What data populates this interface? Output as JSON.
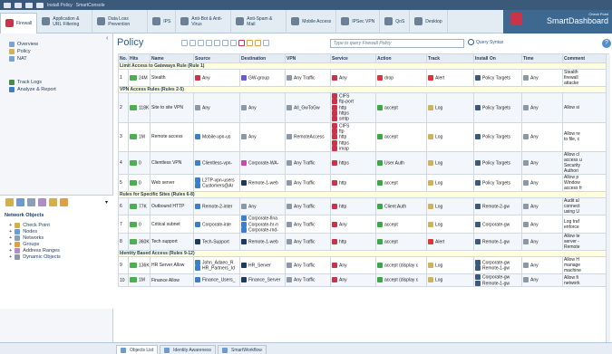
{
  "window": {
    "menu": "Install Policy",
    "console": "SmartConsole"
  },
  "ribbon": [
    {
      "label": "Firewall",
      "color": "#c8354a"
    },
    {
      "label": "Application & URL Filtering",
      "color": "#6b7f95"
    },
    {
      "label": "Data Loss Prevention",
      "color": "#6b7f95"
    },
    {
      "label": "IPS",
      "color": "#6b7f95"
    },
    {
      "label": "Anti-Bot & Anti-Virus",
      "color": "#6b7f95"
    },
    {
      "label": "Anti-Spam & Mail",
      "color": "#6b7f95"
    },
    {
      "label": "Mobile Access",
      "color": "#6b7f95"
    },
    {
      "label": "IPSec VPN",
      "color": "#6b7f95"
    },
    {
      "label": "QoS",
      "color": "#6b7f95"
    },
    {
      "label": "Desktop",
      "color": "#6b7f95"
    }
  ],
  "brand": {
    "vendor": "Check Point",
    "product": "SmartDashboard"
  },
  "leftpane": {
    "top_items": [
      "Overview",
      "Policy",
      "NAT"
    ],
    "mid_items": [
      "Track Logs",
      "Analyze & Report"
    ],
    "tree_title": "Network Objects",
    "tree_items": [
      "Check Point",
      "Nodes",
      "Networks",
      "Groups",
      "Address Ranges",
      "Dynamic Objects"
    ]
  },
  "main": {
    "title": "Policy",
    "search_placeholder": "Type to query Firewall Policy",
    "search_syntax": "Query Syntax",
    "headers": [
      "No.",
      "Hits",
      "Name",
      "Source",
      "Destination",
      "VPN",
      "Service",
      "Action",
      "Track",
      "Install On",
      "Time",
      "Comment"
    ]
  },
  "rows": [
    {
      "type": "section",
      "text": "Limit Access to Gateways Rule  (Rule 1)"
    },
    {
      "type": "rule",
      "no": "1",
      "hits": "24M",
      "name": "Stealth",
      "src": [
        "Any"
      ],
      "dst": [
        "GW-group"
      ],
      "vpn": "Any Traffic",
      "svc": [
        "Any"
      ],
      "action": "drop",
      "action_color": "#d9373a",
      "track": "Alert",
      "install": "Policy Targets",
      "time": "Any",
      "comment": [
        "Stealth",
        "firewall",
        "attacke"
      ],
      "dst_color": "#6b5bd6",
      "src_color": "#c8354a"
    },
    {
      "type": "section",
      "text": "VPN Access Rules  (Rules 2-5)"
    },
    {
      "type": "rule",
      "no": "2",
      "hits": "118K",
      "name": "Site to site VPN",
      "src": [
        "Any"
      ],
      "dst": [
        "Any"
      ],
      "vpn": "All_GwToGw",
      "svc": [
        "CIFS",
        "ftp-port",
        "http",
        "https",
        "smtp"
      ],
      "action": "accept",
      "action_color": "#39a845",
      "track": "Log",
      "install": "Policy Targets",
      "time": "Any",
      "comment": [
        "Allow si"
      ],
      "dst_color": "#8a98a8",
      "src_color": "#8a98a8"
    },
    {
      "type": "rule",
      "no": "3",
      "hits": "1M",
      "name": "Remote access",
      "src": [
        "Mobile-vpn-us"
      ],
      "dst": [
        "Any"
      ],
      "vpn": "RemoteAccess",
      "svc": [
        "CIFS",
        "ftp",
        "http",
        "https",
        "imap"
      ],
      "action": "accept",
      "action_color": "#39a845",
      "track": "Log",
      "install": "Policy Targets",
      "time": "Any",
      "comment": [
        "Allow re",
        "to file, c"
      ],
      "dst_color": "#8a98a8",
      "src_color": "#3b7fc9"
    },
    {
      "type": "rule",
      "no": "4",
      "hits": "0",
      "name": "Clientless VPN",
      "src": [
        "Clientless-vpn-"
      ],
      "dst": [
        "Corporate-WA-"
      ],
      "vpn": "Any Traffic",
      "svc": [
        "https"
      ],
      "action": "User Auth",
      "action_color": "#39a845",
      "track": "Log",
      "install": "Policy Targets",
      "time": "Any",
      "comment": [
        "Allow cl",
        "access u",
        "Security",
        "Authori"
      ],
      "dst_color": "#c84aa8",
      "src_color": "#3b7fc9"
    },
    {
      "type": "rule",
      "no": "5",
      "hits": "0",
      "name": "Web server",
      "src": [
        "L2TP-vpn-users",
        "Customers@Ar"
      ],
      "dst": [
        "Remote-1-web"
      ],
      "vpn": "Any Traffic",
      "svc": [
        "http"
      ],
      "action": "accept",
      "action_color": "#39a845",
      "track": "Log",
      "install": "Policy Targets",
      "time": "Any",
      "comment": [
        "Allow p",
        "Window",
        "access fr"
      ],
      "dst_color": "#1d3a5a",
      "src_color": "#3b7fc9"
    },
    {
      "type": "section",
      "text": "Rules for Specific Sites  (Rules 6-8)"
    },
    {
      "type": "rule",
      "no": "6",
      "hits": "77K",
      "name": "Outbound HTTP",
      "src": [
        "Remote-2-inter"
      ],
      "dst": [
        "Any"
      ],
      "vpn": "Any Traffic",
      "svc": [
        "http"
      ],
      "action": "Client Auth",
      "action_color": "#39a845",
      "track": "Log",
      "install": "Remote-2-gw",
      "time": "Any",
      "comment": [
        "Audit al",
        "connect",
        "using U"
      ],
      "dst_color": "#8a98a8",
      "src_color": "#3b7fc9"
    },
    {
      "type": "rule",
      "no": "7",
      "hits": "0",
      "name": "Critical subnet",
      "src": [
        "Corporate-inte"
      ],
      "dst": [
        "Corporate-fina",
        "Corporate-hr-n",
        "Corporate-rnd-"
      ],
      "vpn": "Any Traffic",
      "svc": [
        "Any"
      ],
      "action": "accept",
      "action_color": "#39a845",
      "track": "Log",
      "install": "Corporate-gw",
      "time": "Any",
      "comment": [
        "Log traf",
        "enforce"
      ],
      "dst_color": "#3b7fc9",
      "src_color": "#3b7fc9"
    },
    {
      "type": "rule",
      "no": "8",
      "hits": "360K",
      "name": "Tech support",
      "src": [
        "Tech-Support"
      ],
      "dst": [
        "Remote-1-web"
      ],
      "vpn": "Any Traffic",
      "svc": [
        "http"
      ],
      "action": "accept",
      "action_color": "#39a845",
      "track": "Alert",
      "install": "Remote-1-gw",
      "time": "Any",
      "comment": [
        "Allow te",
        "server -",
        "Remote"
      ],
      "dst_color": "#1d3a5a",
      "src_color": "#1d3a5a"
    },
    {
      "type": "section",
      "text": "Identity Based Access  (Rules 9-12)"
    },
    {
      "type": "rule",
      "no": "9",
      "hits": "136K",
      "name": "HR Server Allow",
      "src": [
        "John_Adaeo_R",
        "HR_Partners_Id"
      ],
      "dst": [
        "HR_Server"
      ],
      "vpn": "Any Traffic",
      "svc": [
        "Any"
      ],
      "action": "accept (display c",
      "action_color": "#39a845",
      "track": "Log",
      "install": "Corporate-gw",
      "install2": "Remote-1-gw",
      "time": "Any",
      "comment": [
        "Allow H",
        "manage",
        "machine"
      ],
      "dst_color": "#1d3a5a",
      "src_color": "#3b7fc9"
    },
    {
      "type": "rule",
      "no": "10",
      "hits": "1M",
      "name": "Finance Allow",
      "src": [
        "Finance_Users_"
      ],
      "dst": [
        "Finance_Server"
      ],
      "vpn": "Any Traffic",
      "svc": [
        "Any"
      ],
      "action": "accept (display c",
      "action_color": "#39a845",
      "track": "Log",
      "install": "Corporate-gw",
      "install2": "Remote-1-gw",
      "time": "Any",
      "comment": [
        "Allow fi",
        "network"
      ],
      "dst_color": "#1d3a5a",
      "src_color": "#3b7fc9"
    }
  ],
  "bottom_tabs": [
    "Objects List",
    "Identity Awareness",
    "SmartWorkflow"
  ]
}
